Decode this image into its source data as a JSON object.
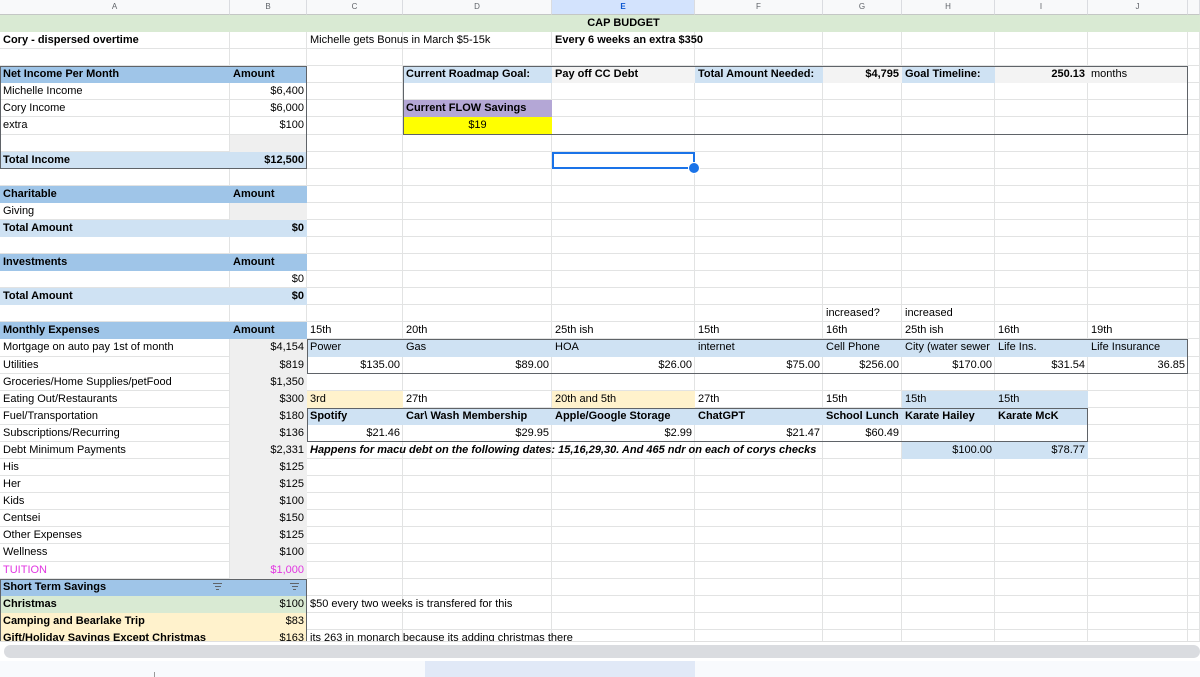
{
  "columns": [
    "A",
    "B",
    "C",
    "D",
    "E",
    "F",
    "G",
    "H",
    "I",
    "J"
  ],
  "selected_column": "E",
  "selected_cell": "E9",
  "colors": {
    "header_blue": "#9fc5e8",
    "light_blue": "#cfe2f3",
    "title_green": "#d9ead3",
    "purple": "#b4a7d6",
    "yellow": "#ffff00",
    "light_orange": "#fff2cc",
    "tuition_magenta": "#e136e1",
    "selection": "#1a73e8"
  },
  "cells": [
    {
      "ref": "E1",
      "text": "CAP BUDGET",
      "s": "b c"
    },
    {
      "ref": "A2",
      "text": "Cory - dispersed overtime",
      "s": "b"
    },
    {
      "ref": "C2",
      "text": "Michelle gets Bonus in March $5-15k",
      "s": ""
    },
    {
      "ref": "E2",
      "text": "Every 6 weeks an extra $350",
      "s": "b"
    },
    {
      "ref": "A4",
      "text": "Net Income Per Month",
      "s": "b hdr"
    },
    {
      "ref": "B4",
      "text": "Amount",
      "s": "b hdr"
    },
    {
      "ref": "D4",
      "text": "Current Roadmap Goal:",
      "s": "b lb"
    },
    {
      "ref": "E4",
      "text": "Pay off CC Debt",
      "s": "b lg"
    },
    {
      "ref": "F4",
      "text": "Total Amount Needed:",
      "s": "b lb"
    },
    {
      "ref": "G4",
      "text": "$4,795",
      "s": "b r lg"
    },
    {
      "ref": "H4",
      "text": "Goal Timeline:",
      "s": "b lb"
    },
    {
      "ref": "I4",
      "text": "250.13",
      "s": "b r lg"
    },
    {
      "ref": "J4",
      "text": "months",
      "s": "lg"
    },
    {
      "ref": "A5",
      "text": "Michelle Income",
      "s": ""
    },
    {
      "ref": "B5",
      "text": "$6,400",
      "s": "r"
    },
    {
      "ref": "A6",
      "text": "Cory Income",
      "s": ""
    },
    {
      "ref": "B6",
      "text": "$6,000",
      "s": "r"
    },
    {
      "ref": "D6",
      "text": "Current FLOW Savings",
      "s": "b pu"
    },
    {
      "ref": "A7",
      "text": "extra",
      "s": ""
    },
    {
      "ref": "B7",
      "text": "$100",
      "s": "r"
    },
    {
      "ref": "D7",
      "text": "$19",
      "s": "c ye"
    },
    {
      "ref": "B8",
      "text": "",
      "s": "gr"
    },
    {
      "ref": "A9",
      "text": "Total Income",
      "s": "b lb"
    },
    {
      "ref": "B9",
      "text": "$12,500",
      "s": "b r lb"
    },
    {
      "ref": "A11",
      "text": "Charitable",
      "s": "b hdr"
    },
    {
      "ref": "B11",
      "text": "Amount",
      "s": "b hdr"
    },
    {
      "ref": "A12",
      "text": "Giving",
      "s": ""
    },
    {
      "ref": "B12",
      "text": "",
      "s": "gr"
    },
    {
      "ref": "A13",
      "text": "Total Amount",
      "s": "b lb"
    },
    {
      "ref": "B13",
      "text": "$0",
      "s": "b r lb"
    },
    {
      "ref": "A15",
      "text": "Investments",
      "s": "b hdr"
    },
    {
      "ref": "B15",
      "text": "Amount",
      "s": "b hdr"
    },
    {
      "ref": "B16",
      "text": "$0",
      "s": "r"
    },
    {
      "ref": "A17",
      "text": "Total Amount",
      "s": "b lb"
    },
    {
      "ref": "B17",
      "text": "$0",
      "s": "b r lb"
    },
    {
      "ref": "G18",
      "text": "increased?",
      "s": ""
    },
    {
      "ref": "H18",
      "text": "increased",
      "s": ""
    },
    {
      "ref": "A19",
      "text": "Monthly Expenses",
      "s": "b hdr"
    },
    {
      "ref": "B19",
      "text": "Amount",
      "s": "b hdr"
    },
    {
      "ref": "C19",
      "text": "15th",
      "s": ""
    },
    {
      "ref": "D19",
      "text": "20th",
      "s": ""
    },
    {
      "ref": "E19",
      "text": "25th ish",
      "s": ""
    },
    {
      "ref": "F19",
      "text": "15th",
      "s": ""
    },
    {
      "ref": "G19",
      "text": "16th",
      "s": ""
    },
    {
      "ref": "H19",
      "text": "25th ish",
      "s": ""
    },
    {
      "ref": "I19",
      "text": "16th",
      "s": ""
    },
    {
      "ref": "J19",
      "text": "19th",
      "s": ""
    },
    {
      "ref": "A20",
      "text": "Mortgage on auto pay 1st of month",
      "s": ""
    },
    {
      "ref": "B20",
      "text": "$4,154",
      "s": "r gr"
    },
    {
      "ref": "C20",
      "text": "Power",
      "s": "lb"
    },
    {
      "ref": "D20",
      "text": "Gas",
      "s": "lb"
    },
    {
      "ref": "E20",
      "text": "HOA",
      "s": "lb"
    },
    {
      "ref": "F20",
      "text": "internet",
      "s": "lb"
    },
    {
      "ref": "G20",
      "text": "Cell Phone",
      "s": "lb"
    },
    {
      "ref": "H20",
      "text": "City (water sewer",
      "s": "lb"
    },
    {
      "ref": "I20",
      "text": "Life Ins.",
      "s": "lb"
    },
    {
      "ref": "J20",
      "text": "Life Insurance",
      "s": "lb"
    },
    {
      "ref": "A21",
      "text": "Utilities",
      "s": ""
    },
    {
      "ref": "B21",
      "text": "$819",
      "s": "r gr"
    },
    {
      "ref": "C21",
      "text": "$135.00",
      "s": "r"
    },
    {
      "ref": "D21",
      "text": "$89.00",
      "s": "r"
    },
    {
      "ref": "E21",
      "text": "$26.00",
      "s": "r"
    },
    {
      "ref": "F21",
      "text": "$75.00",
      "s": "r"
    },
    {
      "ref": "G21",
      "text": "$256.00",
      "s": "r"
    },
    {
      "ref": "H21",
      "text": "$170.00",
      "s": "r"
    },
    {
      "ref": "I21",
      "text": "$31.54",
      "s": "r"
    },
    {
      "ref": "J21",
      "text": "36.85",
      "s": "r"
    },
    {
      "ref": "A22",
      "text": "Groceries/Home Supplies/petFood",
      "s": ""
    },
    {
      "ref": "B22",
      "text": "$1,350",
      "s": "r gr"
    },
    {
      "ref": "A23",
      "text": "Eating Out/Restaurants",
      "s": ""
    },
    {
      "ref": "B23",
      "text": "$300",
      "s": "r gr"
    },
    {
      "ref": "C23",
      "text": "3rd",
      "s": "or"
    },
    {
      "ref": "D23",
      "text": "27th",
      "s": ""
    },
    {
      "ref": "E23",
      "text": "20th and 5th",
      "s": "or"
    },
    {
      "ref": "F23",
      "text": "27th",
      "s": ""
    },
    {
      "ref": "G23",
      "text": "15th",
      "s": ""
    },
    {
      "ref": "H23",
      "text": "15th",
      "s": "lb"
    },
    {
      "ref": "I23",
      "text": "15th",
      "s": "lb"
    },
    {
      "ref": "A24",
      "text": "Fuel/Transportation",
      "s": ""
    },
    {
      "ref": "B24",
      "text": "$180",
      "s": "r gr"
    },
    {
      "ref": "C24",
      "text": "Spotify",
      "s": "b lb"
    },
    {
      "ref": "D24",
      "text": "Car\\ Wash Membership",
      "s": "b lb"
    },
    {
      "ref": "E24",
      "text": "Apple/Google Storage",
      "s": "b lb"
    },
    {
      "ref": "F24",
      "text": "ChatGPT",
      "s": "b lb"
    },
    {
      "ref": "G24",
      "text": "School Lunch",
      "s": "b lb"
    },
    {
      "ref": "H24",
      "text": "Karate Hailey",
      "s": "b lb"
    },
    {
      "ref": "I24",
      "text": "Karate McK",
      "s": "b lb"
    },
    {
      "ref": "A25",
      "text": "Subscriptions/Recurring",
      "s": ""
    },
    {
      "ref": "B25",
      "text": "$136",
      "s": "r gr"
    },
    {
      "ref": "C25",
      "text": "$21.46",
      "s": "r"
    },
    {
      "ref": "D25",
      "text": "$29.95",
      "s": "r"
    },
    {
      "ref": "E25",
      "text": "$2.99",
      "s": "r"
    },
    {
      "ref": "F25",
      "text": "$21.47",
      "s": "r"
    },
    {
      "ref": "G25",
      "text": "$60.49",
      "s": "r"
    },
    {
      "ref": "A26",
      "text": "Debt Minimum Payments",
      "s": ""
    },
    {
      "ref": "B26",
      "text": "$2,331",
      "s": "r gr"
    },
    {
      "ref": "C26",
      "text": "Happens for macu debt on the following dates: 15,16,29,30. And 465 ndr on each of corys checks",
      "s": "b i"
    },
    {
      "ref": "H26",
      "text": "$100.00",
      "s": "r lb"
    },
    {
      "ref": "I26",
      "text": "$78.77",
      "s": "r lb"
    },
    {
      "ref": "A27",
      "text": "His",
      "s": ""
    },
    {
      "ref": "B27",
      "text": "$125",
      "s": "r gr"
    },
    {
      "ref": "A28",
      "text": "Her",
      "s": ""
    },
    {
      "ref": "B28",
      "text": "$125",
      "s": "r gr"
    },
    {
      "ref": "A29",
      "text": "Kids",
      "s": ""
    },
    {
      "ref": "B29",
      "text": "$100",
      "s": "r gr"
    },
    {
      "ref": "A30",
      "text": "Centsei",
      "s": ""
    },
    {
      "ref": "B30",
      "text": "$150",
      "s": "r gr"
    },
    {
      "ref": "A31",
      "text": "Other Expenses",
      "s": ""
    },
    {
      "ref": "B31",
      "text": "$125",
      "s": "r gr"
    },
    {
      "ref": "A32",
      "text": "Wellness",
      "s": ""
    },
    {
      "ref": "B32",
      "text": "$100",
      "s": "r gr"
    },
    {
      "ref": "A33",
      "text": "TUITION",
      "s": "mg"
    },
    {
      "ref": "B33",
      "text": "$1,000",
      "s": "r gr mg"
    },
    {
      "ref": "A34",
      "text": "Short Term Savings",
      "s": "b hdr",
      "filter": true
    },
    {
      "ref": "B34",
      "text": "",
      "s": "hdr",
      "filter": true
    },
    {
      "ref": "A35",
      "text": "Christmas",
      "s": "b gn"
    },
    {
      "ref": "B35",
      "text": "$100",
      "s": "r gn"
    },
    {
      "ref": "C35",
      "text": "$50 every two weeks is transfered for this",
      "s": ""
    },
    {
      "ref": "A36",
      "text": "Camping and Bearlake Trip",
      "s": "b or"
    },
    {
      "ref": "B36",
      "text": "$83",
      "s": "r or"
    },
    {
      "ref": "A37",
      "text": "Gift/Holiday Savings Except Christmas",
      "s": "b or"
    },
    {
      "ref": "B37",
      "text": "$163",
      "s": "r or"
    },
    {
      "ref": "C37",
      "text": "its 263 in monarch because its adding christmas there",
      "s": ""
    }
  ],
  "boxes": [
    "A4:B9",
    "D4:J7",
    "C20:J21",
    "C24:I25",
    "A34:B37"
  ]
}
